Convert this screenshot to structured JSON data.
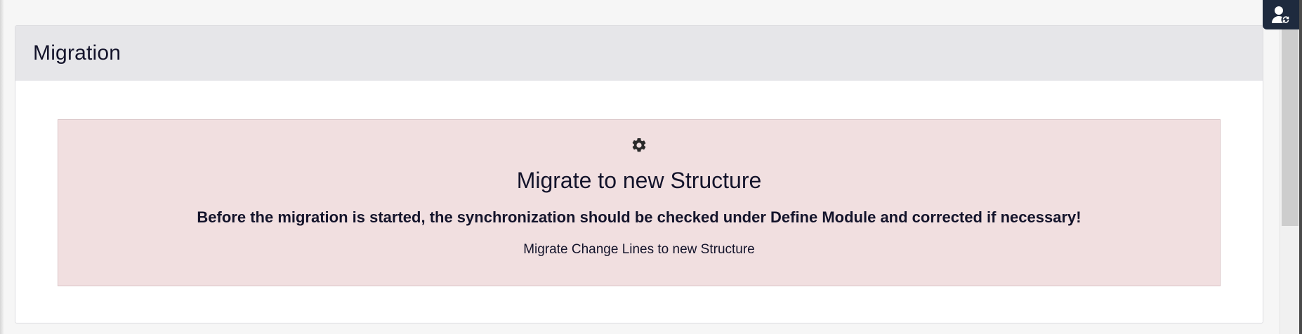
{
  "panel": {
    "title": "Migration"
  },
  "alert": {
    "icon": "gear-icon",
    "title": "Migrate to new Structure",
    "warning": "Before the migration is started, the synchronization should be checked under Define Module and corrected if necessary!",
    "link_label": "Migrate Change Lines to new Structure",
    "background_color": "#f1dfe0",
    "border_color": "#d9c3c5"
  },
  "user_button": {
    "icon": "user-switch-icon",
    "background_color": "#1e2a3e"
  }
}
